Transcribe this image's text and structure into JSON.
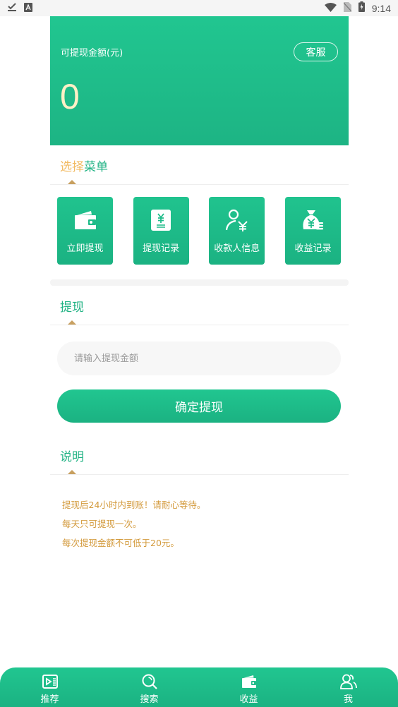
{
  "status_bar": {
    "left_icons": [
      "download-done-icon",
      "keyboard-a-icon"
    ],
    "right_icons": [
      "wifi-icon",
      "no-sim-icon",
      "battery-charging-icon"
    ],
    "time": "9:14"
  },
  "balance_card": {
    "label": "可提现金额(元)",
    "service_button": "客服",
    "amount": "0"
  },
  "menu_section": {
    "title_part1": "选择",
    "title_part2": "菜单",
    "items": [
      {
        "label": "立即提现",
        "icon": "wallet-icon"
      },
      {
        "label": "提现记录",
        "icon": "yuan-receipt-icon"
      },
      {
        "label": "收款人信息",
        "icon": "user-yuan-icon"
      },
      {
        "label": "收益记录",
        "icon": "money-bag-icon"
      }
    ]
  },
  "withdraw_section": {
    "title": "提现",
    "input_placeholder": "请输入提现金额",
    "input_value": "",
    "confirm_button": "确定提现"
  },
  "notes_section": {
    "title": "说明",
    "lines": [
      "提现后24小时内到账！请耐心等待。",
      "每天只可提现一次。",
      "每次提现金额不可低于20元。"
    ]
  },
  "bottom_nav": {
    "items": [
      {
        "label": "推荐",
        "icon": "video-list-icon"
      },
      {
        "label": "搜索",
        "icon": "search-icon"
      },
      {
        "label": "收益",
        "icon": "wallet-icon"
      },
      {
        "label": "我",
        "icon": "user-icon"
      }
    ],
    "active_index": 2
  },
  "colors": {
    "primary": "#1fbf8c",
    "accent_orange": "#f2bb63",
    "note_text": "#d39a3c",
    "balance_value": "#fdf0c6"
  }
}
